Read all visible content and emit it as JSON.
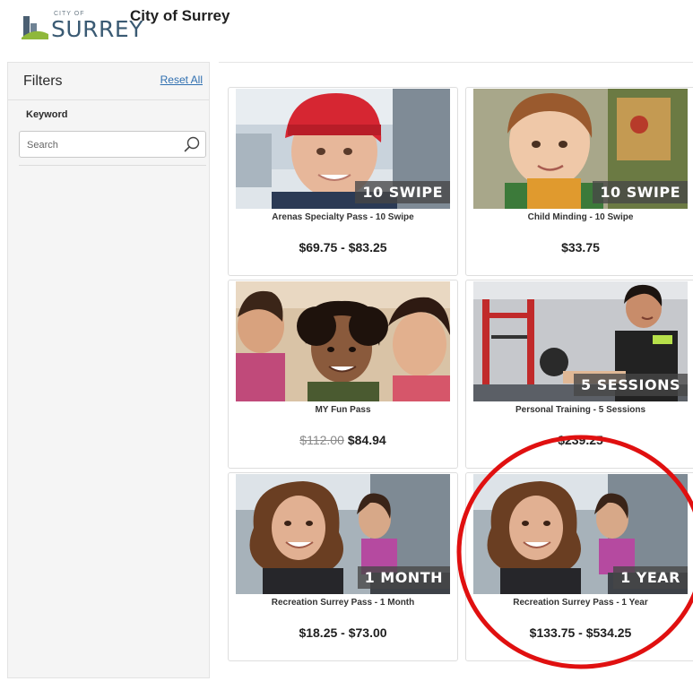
{
  "header": {
    "logo_small": "CITY OF",
    "logo_word": "SURREY",
    "title": "City of Surrey"
  },
  "filters": {
    "title": "Filters",
    "reset_label": "Reset All",
    "keyword_label": "Keyword",
    "search_placeholder": "Search"
  },
  "products": [
    {
      "name": "Arenas Specialty Pass - 10 Swipe",
      "badge": "10 SWIPE",
      "price": "$69.75 - $83.25"
    },
    {
      "name": "Child Minding - 10 Swipe",
      "badge": "10 SWIPE",
      "price": "$33.75"
    },
    {
      "name": "MY Fun Pass",
      "badge": "",
      "price_old": "$112.00",
      "price": "$84.94"
    },
    {
      "name": "Personal Training - 5 Sessions",
      "badge": "5 SESSIONS",
      "price": "$239.25"
    },
    {
      "name": "Recreation Surrey Pass - 1 Month",
      "badge": "1 MONTH",
      "price": "$18.25 - $73.00"
    },
    {
      "name": "Recreation Surrey Pass - 1 Year",
      "badge": "1 YEAR",
      "price": "$133.75 - $534.25"
    }
  ],
  "colors": {
    "link": "#2f6fb0",
    "annotation_circle": "#e01010",
    "sidebar_bg": "#f5f5f5"
  },
  "icons": {
    "search": "search-icon",
    "logo": "surrey-logo-icon"
  }
}
